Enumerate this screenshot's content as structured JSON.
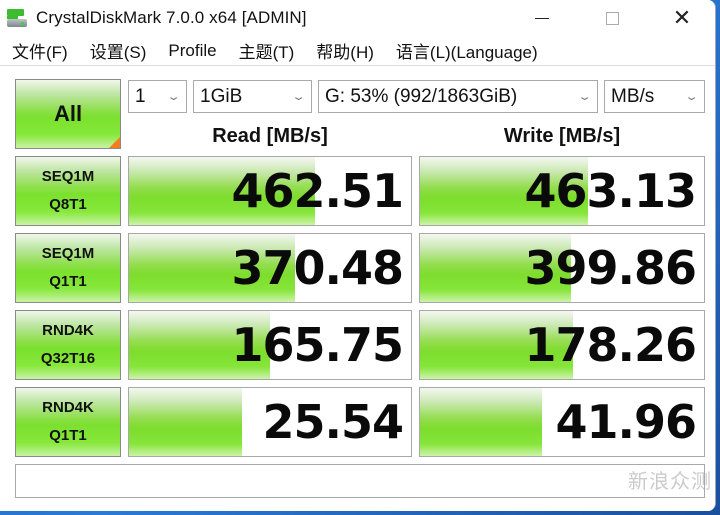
{
  "window": {
    "title": "CrystalDiskMark 7.0.0 x64 [ADMIN]",
    "icon": "crystaldiskmark-app-icon",
    "controls": {
      "minimize": "minimize-icon",
      "maximize": "maximize-icon",
      "close": "✕"
    }
  },
  "menu": {
    "items": [
      {
        "label": "文件(F)"
      },
      {
        "label": "设置(S)"
      },
      {
        "label": "Profile"
      },
      {
        "label": "主题(T)"
      },
      {
        "label": "帮助(H)"
      },
      {
        "label": "语言(L)(Language)"
      }
    ]
  },
  "toolbar": {
    "all_button": "All",
    "count": {
      "value": "1",
      "options_visible": [
        "1"
      ]
    },
    "size": {
      "value": "1GiB"
    },
    "drive": {
      "value": "G: 53% (992/1863GiB)"
    },
    "unit": {
      "value": "MB/s"
    }
  },
  "headers": {
    "read": "Read [MB/s]",
    "write": "Write [MB/s]"
  },
  "tests": [
    {
      "line1": "SEQ1M",
      "line2": "Q8T1",
      "read": "462.51",
      "write": "463.13",
      "read_fill": 0.66,
      "write_fill": 0.59
    },
    {
      "line1": "SEQ1M",
      "line2": "Q1T1",
      "read": "370.48",
      "write": "399.86",
      "read_fill": 0.59,
      "write_fill": 0.53
    },
    {
      "line1": "RND4K",
      "line2": "Q32T16",
      "read": "165.75",
      "write": "178.26",
      "read_fill": 0.5,
      "write_fill": 0.54
    },
    {
      "line1": "RND4K",
      "line2": "Q1T1",
      "read": "25.54",
      "write": "41.96",
      "read_fill": 0.4,
      "write_fill": 0.43
    }
  ],
  "comment": {
    "value": ""
  },
  "watermark": "新浪众测",
  "colors": {
    "accent_green": "#7ddd2c",
    "corner_orange": "#f57c1f"
  }
}
